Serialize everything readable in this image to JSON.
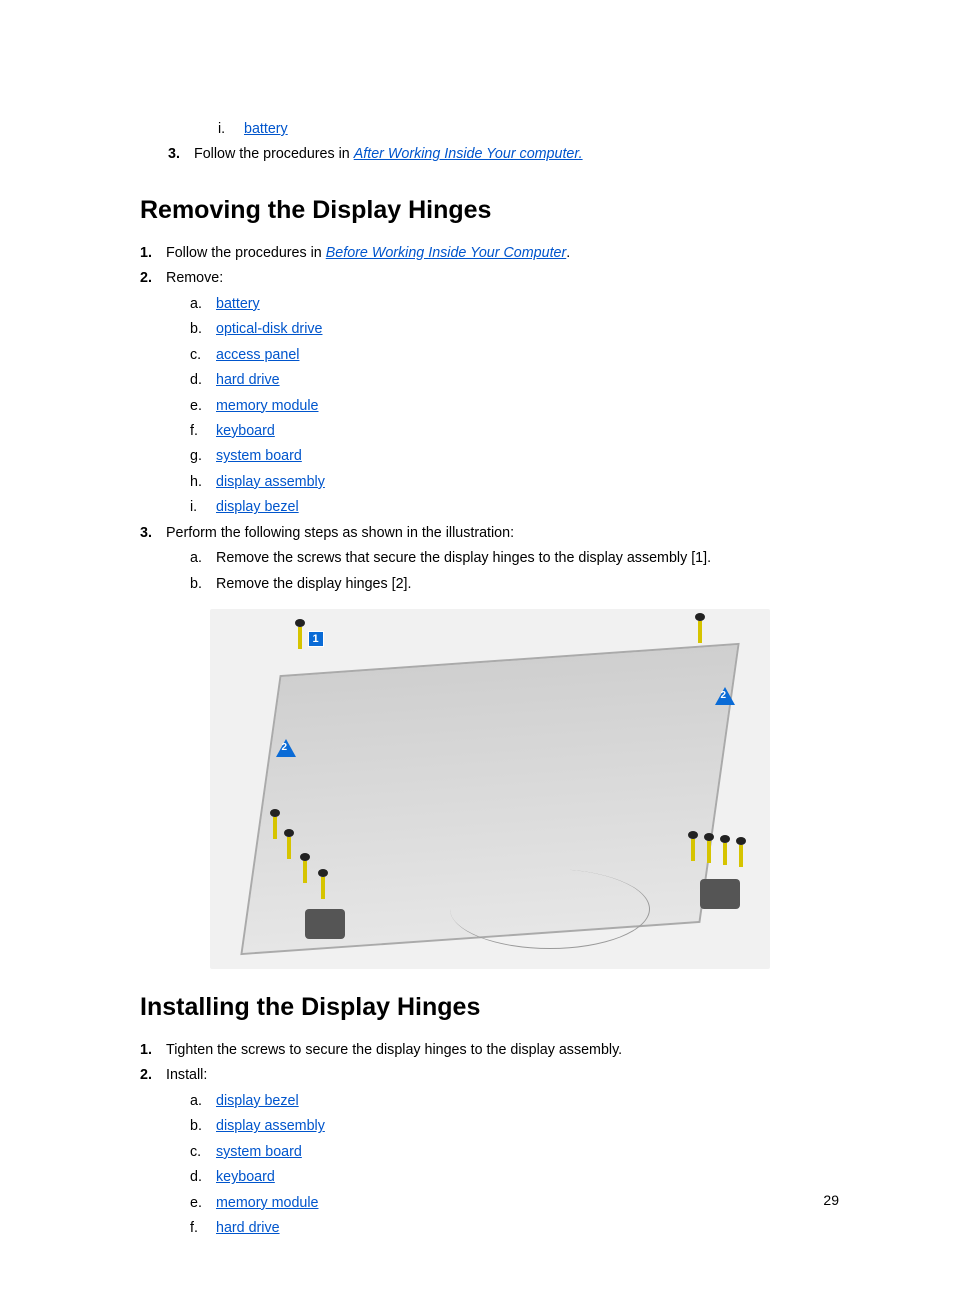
{
  "intro": {
    "p_i_marker": "i.",
    "p_i_link": "battery",
    "p3_marker": "3.",
    "p3_text_before": "Follow the procedures in ",
    "p3_link": "After Working Inside Your computer."
  },
  "removing": {
    "heading": "Removing the Display Hinges",
    "s1_marker": "1.",
    "s1_text_before": "Follow the procedures in ",
    "s1_link": "Before Working Inside Your Computer",
    "s1_text_after": ".",
    "s2_marker": "2.",
    "s2_text": "Remove:",
    "sub": [
      {
        "m": "a.",
        "link": "battery"
      },
      {
        "m": "b.",
        "link": "optical-disk drive"
      },
      {
        "m": "c.",
        "link": "access panel"
      },
      {
        "m": "d.",
        "link": "hard drive"
      },
      {
        "m": "e.",
        "link": "memory module"
      },
      {
        "m": "f.",
        "link": "keyboard"
      },
      {
        "m": "g.",
        "link": "system board"
      },
      {
        "m": "h.",
        "link": "display assembly"
      },
      {
        "m": "i.",
        "link": "display bezel"
      }
    ],
    "s3_marker": "3.",
    "s3_text": "Perform the following steps as shown in the illustration:",
    "s3_sub": [
      {
        "m": "a.",
        "text": "Remove the screws that secure the display hinges to the display assembly [1]."
      },
      {
        "m": "b.",
        "text": "Remove the display hinges [2]."
      }
    ]
  },
  "illustration": {
    "callout1": "1",
    "callout2": "2"
  },
  "installing": {
    "heading": "Installing the Display Hinges",
    "s1_marker": "1.",
    "s1_text": "Tighten the screws to secure the display hinges to the display assembly.",
    "s2_marker": "2.",
    "s2_text": "Install:",
    "sub": [
      {
        "m": "a.",
        "link": "display bezel"
      },
      {
        "m": "b.",
        "link": "display assembly"
      },
      {
        "m": "c.",
        "link": "system board"
      },
      {
        "m": "d.",
        "link": "keyboard"
      },
      {
        "m": "e.",
        "link": "memory module"
      },
      {
        "m": "f.",
        "link": "hard drive"
      }
    ]
  },
  "page_number": "29"
}
